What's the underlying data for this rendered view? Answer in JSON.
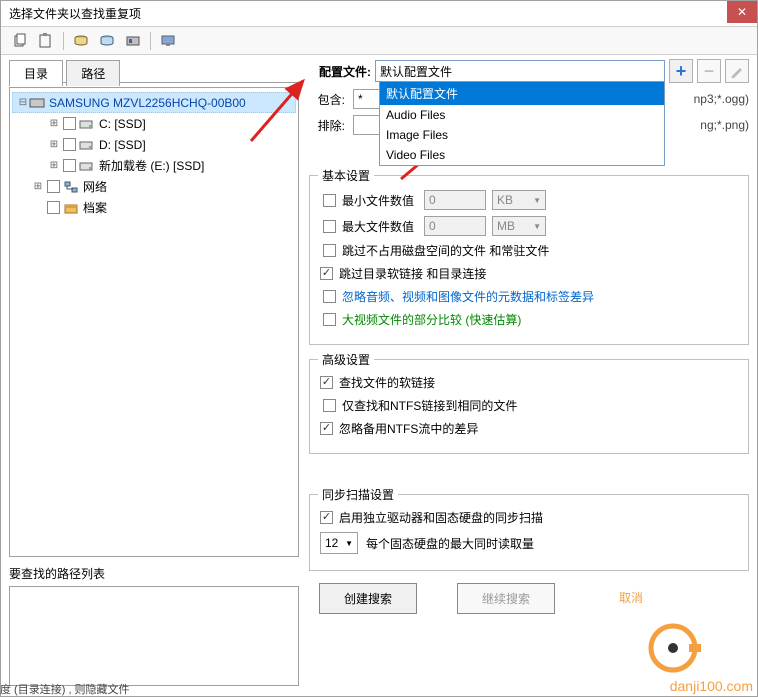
{
  "title": "选择文件夹以查找重复项",
  "tabs": {
    "dir": "目录",
    "path": "路径"
  },
  "tree": {
    "root": "SAMSUNG MZVL2256HCHQ-00B00",
    "c": "C: [SSD]",
    "d": "D: [SSD]",
    "e": "新加载卷 (E:) [SSD]",
    "network": "网络",
    "archive": "档案"
  },
  "path_list_label": "要查找的路径列表",
  "config": {
    "label": "配置文件:",
    "value": "默认配置文件",
    "options": [
      "默认配置文件",
      "Audio Files",
      "Image Files",
      "Video Files"
    ]
  },
  "include": {
    "label": "包含:",
    "value": "*",
    "trail": "np3;*.ogg)"
  },
  "exclude": {
    "label": "排除:",
    "value": "",
    "trail": "ng;*.png)"
  },
  "basic": {
    "legend": "基本设置",
    "min_label": "最小文件数值",
    "min_val": "0",
    "min_unit": "KB",
    "max_label": "最大文件数值",
    "max_val": "0",
    "max_unit": "MB",
    "skip_zero": "跳过不占用磁盘空间的文件 和常驻文件",
    "skip_link": "跳过目录软链接 和目录连接",
    "ignore_meta": "忽略音频、视频和图像文件的元数据和标签差异",
    "big_video": "大视频文件的部分比较 (快速估算)"
  },
  "adv": {
    "legend": "高级设置",
    "find_soft": "查找文件的软链接",
    "ntfs_same": "仅查找和NTFS链接到相同的文件",
    "ntfs_backup": "忽略备用NTFS流中的差异"
  },
  "sync": {
    "legend": "同步扫描设置",
    "enable": "启用独立驱动器和固态硬盘的同步扫描",
    "sel": "12",
    "label": "每个固态硬盘的最大同时读取量"
  },
  "buttons": {
    "create": "创建搜索",
    "continue": "继续搜索",
    "cancel": "取消"
  },
  "cut_text": "度 (目录连接) , 则隐藏文件",
  "watermark": "danji100.com"
}
